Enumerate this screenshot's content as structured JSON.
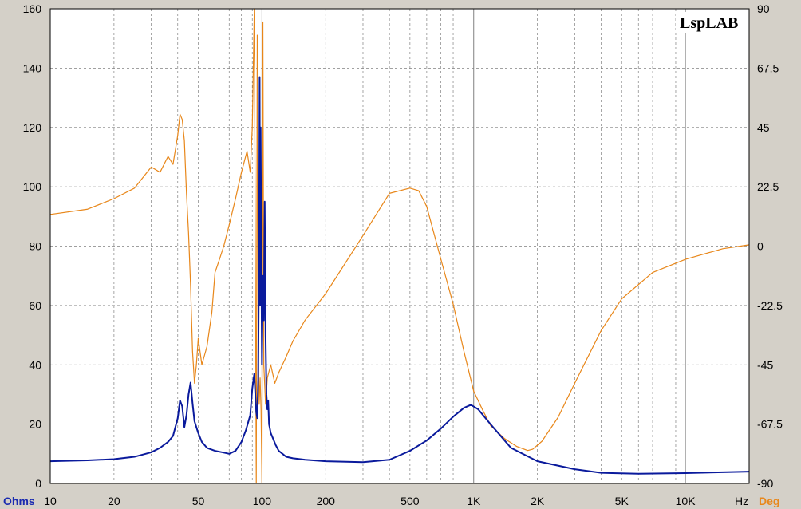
{
  "brand": "LspLAB",
  "chart_data": {
    "type": "line",
    "xscale": "log",
    "xlim": [
      10,
      20000
    ],
    "ylim": [
      0,
      160
    ],
    "y2lim": [
      -90,
      90
    ],
    "grid": true,
    "x_ticks": [
      {
        "value": 10,
        "label": "10"
      },
      {
        "value": 20,
        "label": "20"
      },
      {
        "value": 50,
        "label": "50"
      },
      {
        "value": 100,
        "label": "100"
      },
      {
        "value": 200,
        "label": "200"
      },
      {
        "value": 500,
        "label": "500"
      },
      {
        "value": 1000,
        "label": "1K"
      },
      {
        "value": 2000,
        "label": "2K"
      },
      {
        "value": 5000,
        "label": "5K"
      },
      {
        "value": 10000,
        "label": "10K"
      }
    ],
    "y_ticks": [
      0,
      20,
      40,
      60,
      80,
      100,
      120,
      140,
      160
    ],
    "y2_ticks": [
      "-90",
      "-67.5",
      "-45",
      "-22.5",
      "0",
      "22.5",
      "45",
      "67.5",
      "90"
    ],
    "xunit": "Hz",
    "yunit_left": "Ohms",
    "yunit_right": "Deg",
    "colors": {
      "impedance": "#0a1a9c",
      "phase": "#e8871a",
      "plot_bg": "#ffffff",
      "frame_bg": "#d4d0c8",
      "grid": "#808080"
    },
    "series": [
      {
        "axis": "left",
        "x": [
          10,
          15,
          20,
          25,
          30,
          33,
          36,
          38,
          40,
          41,
          42,
          43,
          44,
          45,
          46,
          47,
          48,
          50,
          52,
          55,
          60,
          65,
          70,
          75,
          80,
          84,
          88,
          90,
          92,
          93,
          94,
          95,
          96,
          97,
          97.5,
          98,
          98.5,
          99,
          100,
          101,
          102,
          103,
          104,
          105,
          106,
          107,
          108,
          110,
          113,
          116,
          120,
          125,
          130,
          140,
          160,
          200,
          300,
          400,
          500,
          600,
          700,
          800,
          900,
          970,
          1050,
          1200,
          1500,
          2000,
          3000,
          4000,
          6000,
          10000,
          20000
        ],
        "y": [
          7.5,
          7.8,
          8.2,
          9,
          10.5,
          12,
          14,
          16,
          22,
          28,
          26,
          19,
          23,
          30,
          34,
          27,
          21,
          17,
          14,
          12,
          11,
          10.5,
          10,
          11,
          14,
          18,
          23,
          32,
          37,
          30,
          24,
          22,
          35,
          88,
          137,
          60,
          120,
          92,
          40,
          70,
          55,
          95,
          50,
          30,
          25,
          28,
          20,
          17,
          15,
          13,
          11,
          10,
          9,
          8.5,
          8,
          7.5,
          7.2,
          8,
          11,
          14.5,
          18.5,
          22.5,
          25.5,
          26.5,
          25,
          20,
          12,
          7.5,
          4.8,
          3.6,
          3.3,
          3.5,
          4
        ]
      },
      {
        "axis": "right",
        "x": [
          10,
          15,
          20,
          25,
          30,
          33,
          36,
          38,
          40,
          41,
          42,
          43,
          44,
          45,
          46,
          47,
          48,
          49,
          50,
          52,
          55,
          58,
          60,
          63,
          66,
          70,
          75,
          80,
          85,
          88,
          90,
          92,
          94,
          95,
          96,
          97,
          98,
          99,
          100,
          101,
          102,
          104,
          106,
          110,
          115,
          120,
          130,
          140,
          160,
          200,
          300,
          400,
          500,
          550,
          600,
          700,
          800,
          900,
          1000,
          1100,
          1200,
          1400,
          1600,
          1800,
          1900,
          2100,
          2500,
          3000,
          4000,
          5000,
          7000,
          10000,
          15000,
          20000
        ],
        "y": [
          12,
          14,
          18,
          22,
          30,
          28,
          34,
          31,
          42,
          50,
          48,
          40,
          20,
          5,
          -15,
          -40,
          -52,
          -45,
          -35,
          -45,
          -38,
          -25,
          -10,
          -5,
          0,
          8,
          18,
          28,
          36,
          28,
          45,
          90,
          -90,
          80,
          -40,
          -60,
          -50,
          -62,
          -90,
          85,
          -45,
          -60,
          -50,
          -45,
          -52,
          -48,
          -42,
          -36,
          -28,
          -18,
          4,
          20,
          22,
          21,
          15,
          -5,
          -22,
          -40,
          -55,
          -62,
          -68,
          -73,
          -76,
          -77.5,
          -77,
          -74,
          -65,
          -52,
          -32,
          -20,
          -10,
          -5,
          -1,
          0.5
        ]
      }
    ]
  }
}
